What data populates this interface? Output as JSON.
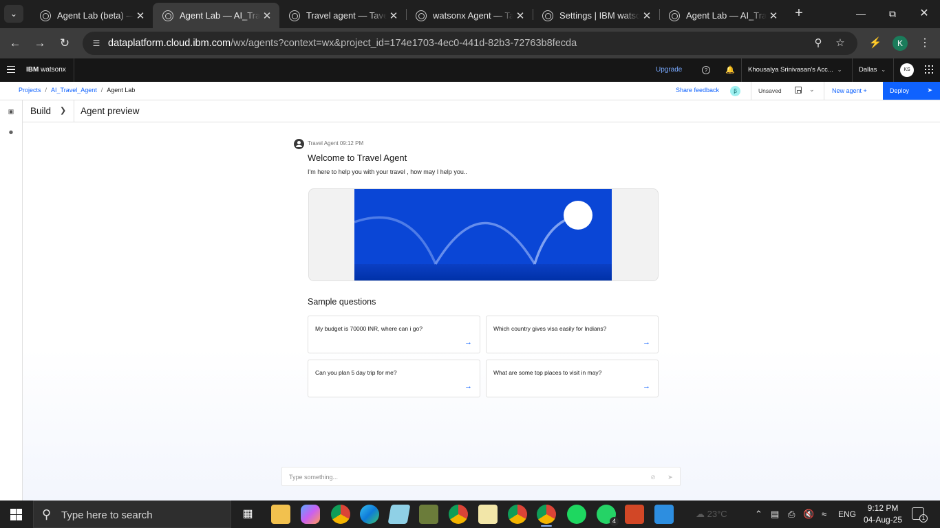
{
  "browser": {
    "tabs": [
      {
        "title": "Agent Lab (beta) — D",
        "active": false
      },
      {
        "title": "Agent Lab — AI_Trave",
        "active": true
      },
      {
        "title": "Travel agent — Tavel_",
        "active": false
      },
      {
        "title": "watsonx Agent — Tav",
        "active": false
      },
      {
        "title": "Settings | IBM watson",
        "active": false
      },
      {
        "title": "Agent Lab — AI_Trave",
        "active": false
      }
    ],
    "url_host": "dataplatform.cloud.ibm.com",
    "url_path": "/wx/agents?context=wx&project_id=174e1703-4ec0-441d-82b3-72763b8fecda",
    "profile_initial": "K"
  },
  "header": {
    "brand_bold": "IBM",
    "brand_light": " watsonx",
    "upgrade": "Upgrade",
    "account": "Khousalya Srinivasan's Acc...",
    "region": "Dallas",
    "avatar": "KS"
  },
  "breadcrumb": {
    "items": [
      "Projects",
      "AI_Travel_Agent",
      "Agent Lab"
    ]
  },
  "actions": {
    "share_feedback": "Share feedback",
    "beta_badge": "β",
    "save_state": "Unsaved",
    "new_agent": "New agent  +",
    "deploy": "Deploy"
  },
  "subheader": {
    "build": "Build",
    "preview": "Agent preview"
  },
  "chat": {
    "agent_name": "Travel Agent",
    "timestamp": "09:12 PM",
    "welcome_title": "Welcome to Travel Agent",
    "intro": "I'm here to help you with your travel , how may I help you..",
    "sample_title": "Sample questions",
    "sample_questions": [
      "My budget is 70000 INR, where can i go?",
      "Which country gives visa easily for Indians?",
      "Can you plan 5 day trip for me?",
      "What are some top places to visit in may?"
    ],
    "input_placeholder": "Type something..."
  },
  "taskbar": {
    "search_placeholder": "Type here to search",
    "language": "ENG",
    "time": "9:12 PM",
    "date": "04-Aug-25",
    "weather": "23°C",
    "notification_count": "1",
    "whatsapp_badge": "4"
  },
  "colors": {
    "accent": "#0f62fe",
    "header_bg": "#161616",
    "hero_blue": "#0043ce"
  }
}
